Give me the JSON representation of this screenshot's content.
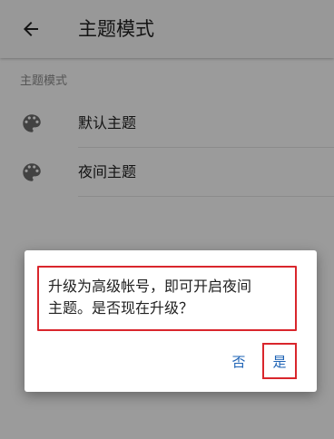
{
  "toolbar": {
    "back_icon": "arrow-back-icon",
    "title": "主题模式"
  },
  "section": {
    "header": "主题模式"
  },
  "themes": [
    {
      "icon": "palette-icon",
      "label": "默认主题"
    },
    {
      "icon": "palette-icon",
      "label": "夜间主题"
    }
  ],
  "dialog": {
    "message_line1": "升级为高级帐号，即可开启夜间",
    "message_line2": "主题。是否现在升级？",
    "negative_label": "否",
    "positive_label": "是"
  },
  "colors": {
    "accent": "#1e63b5",
    "highlight": "#d9262c"
  }
}
